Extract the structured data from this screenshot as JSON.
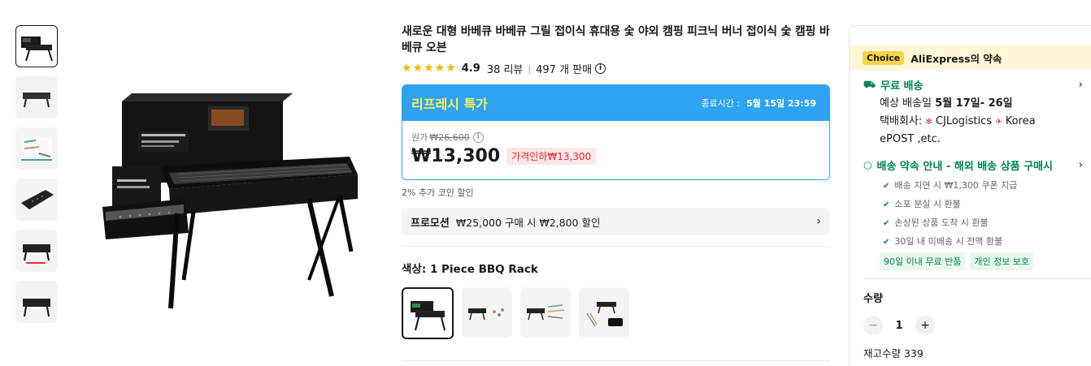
{
  "product": {
    "title": "새로운 대형 바베큐 바베큐 그릴 접이식 휴대용 숯 야외 캠핑 피크닉 버너 접이식 숯 캠핑 바베큐 오븐",
    "stars": "★★★★★",
    "rating": "4.9",
    "reviews": "38 리뷰",
    "separator": "|",
    "sold": "497 개 판매",
    "info_icon": "i"
  },
  "deal": {
    "name": "리프레시 특가",
    "end_label": "종료시간 :",
    "end_time": "5월 15일 23:59",
    "original_label": "원가",
    "original_price": "₩26,600",
    "price": "₩13,300",
    "discount_badge": "가격인하₩13,300",
    "coin_text": "2% 추가 코인 할인"
  },
  "promotion": {
    "tag": "프로모션",
    "text": "₩25,000 구매 시 ₩2,800 할인",
    "chevron": "›"
  },
  "variant_section": {
    "label": "색상: 1 Piece BBQ Rack"
  },
  "right_panel": {
    "choice_badge": "Choice",
    "choice_title": "AliExpress의 약속",
    "shipping": {
      "icon": "⛟",
      "title": "무료 배송",
      "chevron": "›",
      "eta_label": "예상 배송일",
      "eta_dates": "5월 17일- 26일",
      "carrier_label": "택배회사:",
      "carrier_1": "CJLogistics",
      "carrier_2": "Korea",
      "carrier_3": "ePOST ,etc."
    },
    "promise": {
      "icon": "⬡",
      "title": "배송 약속 안내 - 해외 배송 상품 구매시",
      "chevron": "›",
      "items": [
        "배송 지연 시 ₩1,300 쿠폰 지급",
        "소포 분실 시 환불",
        "손상된 상품 도착 시 환불",
        "30일 내 미배송 시 전액 환불"
      ],
      "check": "✔",
      "tags": [
        "90일 이내 무료 반품",
        "개인 정보 보호"
      ]
    },
    "quantity": {
      "title": "수량",
      "minus": "−",
      "value": "1",
      "plus": "+",
      "stock": "재고수량 339"
    }
  },
  "colors": {
    "deal_blue": "#2ea3f2",
    "deal_name_yellow": "#ffef5f",
    "promise_green": "#00864d",
    "discount_red": "#e0283a",
    "star_gold": "#f7b500",
    "choice_yellow": "#f8d44c"
  }
}
